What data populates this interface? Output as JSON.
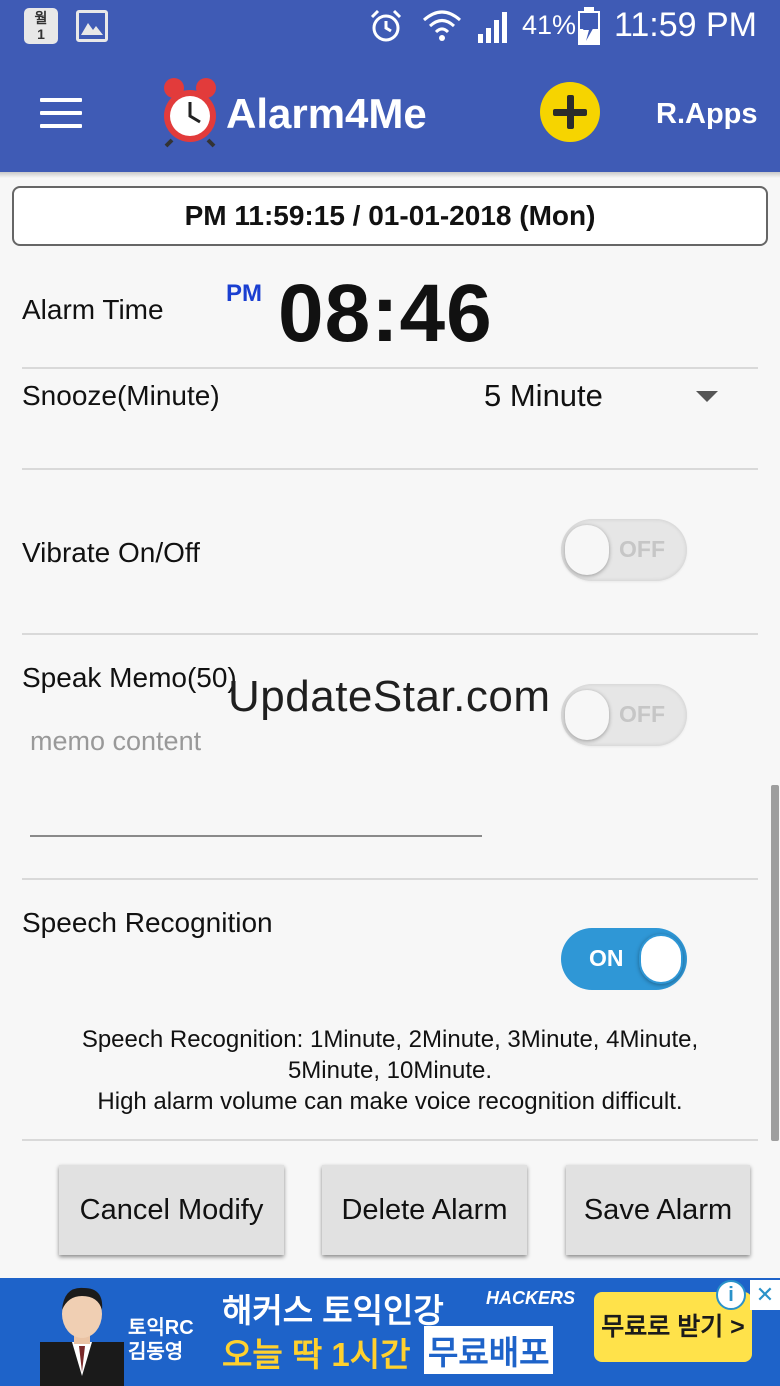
{
  "status_bar": {
    "calendar_text": "월\n1",
    "battery_percent": "41%",
    "time": "11:59 PM"
  },
  "toolbar": {
    "title": "Alarm4Me",
    "rapps_label": "R.Apps"
  },
  "current_datetime": "PM 11:59:15 / 01-01-2018 (Mon)",
  "alarm": {
    "label": "Alarm Time",
    "ampm": "PM",
    "time": "08:46"
  },
  "snooze": {
    "label": "Snooze(Minute)",
    "value": "5 Minute"
  },
  "vibrate": {
    "label": "Vibrate On/Off",
    "state": "OFF"
  },
  "speak_memo": {
    "label": "Speak Memo(50)",
    "state": "OFF",
    "placeholder": "memo content"
  },
  "speech_recognition": {
    "label": "Speech Recognition",
    "state": "ON",
    "info_line1": "Speech Recognition: 1Minute, 2Minute, 3Minute, 4Minute,",
    "info_line2": "5Minute, 10Minute.",
    "info_line3": "High alarm volume can make voice recognition difficult."
  },
  "watermark": "UpdateStar.com",
  "buttons": {
    "cancel": "Cancel Modify",
    "delete": "Delete Alarm",
    "save": "Save Alarm"
  },
  "ad": {
    "name_line1": "토익RC",
    "name_line2": "김동영",
    "text1": "해커스 토익인강",
    "brand": "HACKERS",
    "text2a": "오늘 딱 1시간",
    "text2b": "무료배포",
    "cta": "무료로 받기 >",
    "info_glyph": "i",
    "close_glyph": "✕"
  },
  "colors": {
    "primary": "#3f5bb5",
    "accent_yellow": "#f6d400",
    "toggle_on": "#2f97d6",
    "ampm_blue": "#1a3fd1",
    "ad_blue": "#1e63c9"
  }
}
